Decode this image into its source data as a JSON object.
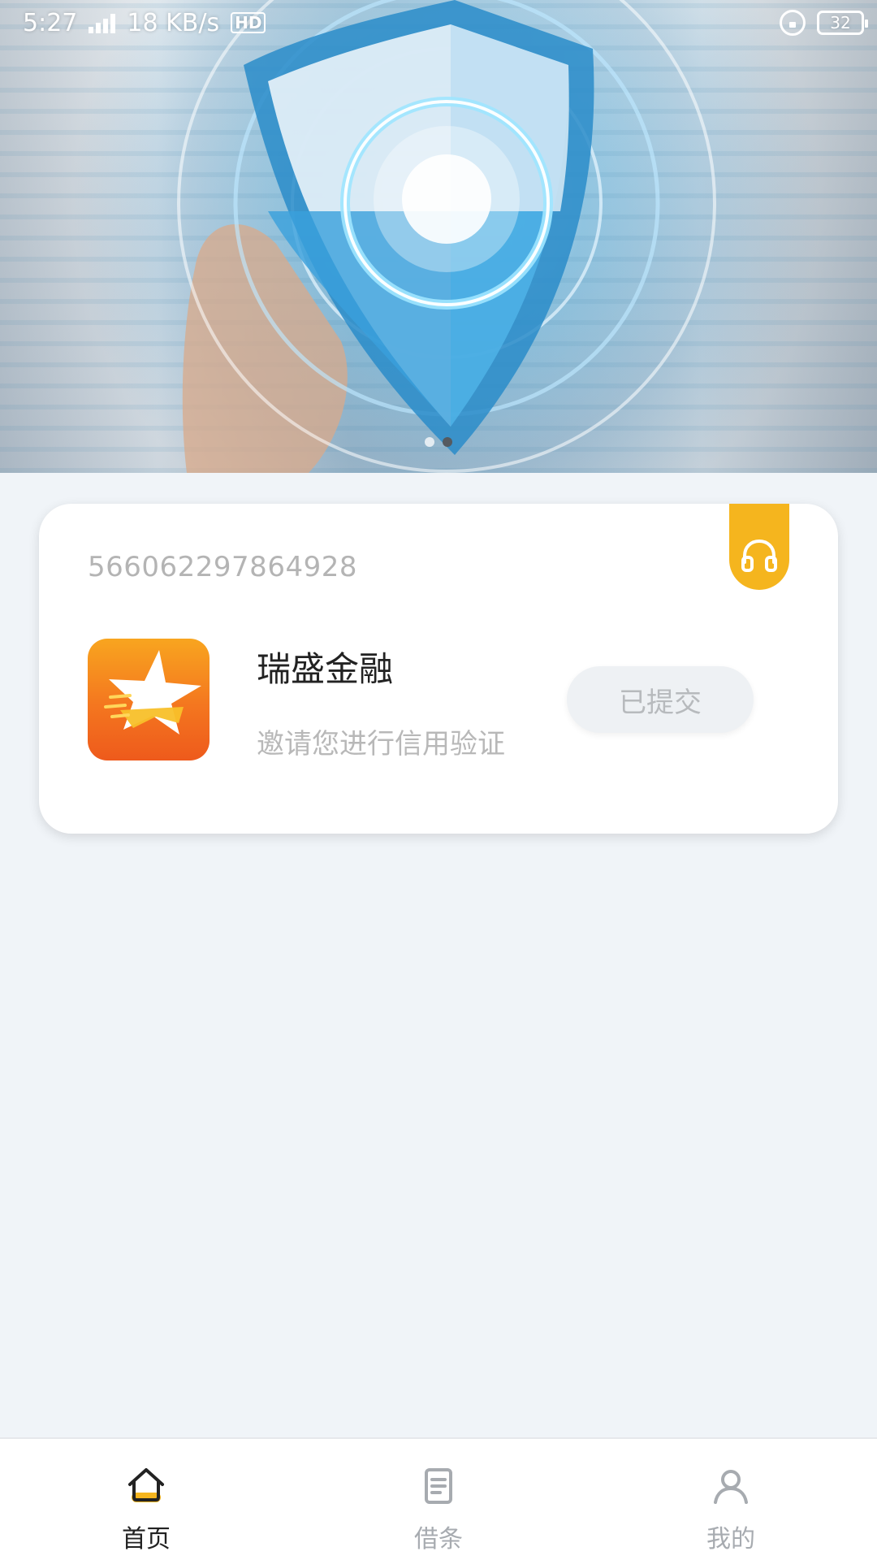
{
  "status_bar": {
    "time": "5:27",
    "network_speed": "18 KB/s",
    "hd_label": "HD",
    "battery": "32"
  },
  "banner": {
    "slide_count": 2,
    "active_slide": 2
  },
  "card": {
    "id_number": "566062297864928",
    "app_name": "瑞盛金融",
    "subtitle": "邀请您进行信用验证",
    "status_button": "已提交",
    "support_icon": "headset-icon"
  },
  "bottom_nav": {
    "items": [
      {
        "label": "首页",
        "icon": "home-icon",
        "active": true
      },
      {
        "label": "借条",
        "icon": "document-icon",
        "active": false
      },
      {
        "label": "我的",
        "icon": "person-icon",
        "active": false
      }
    ]
  },
  "colors": {
    "accent": "#f5b51e",
    "background": "#f0f4f8",
    "inactive_text": "#a7abb0"
  }
}
